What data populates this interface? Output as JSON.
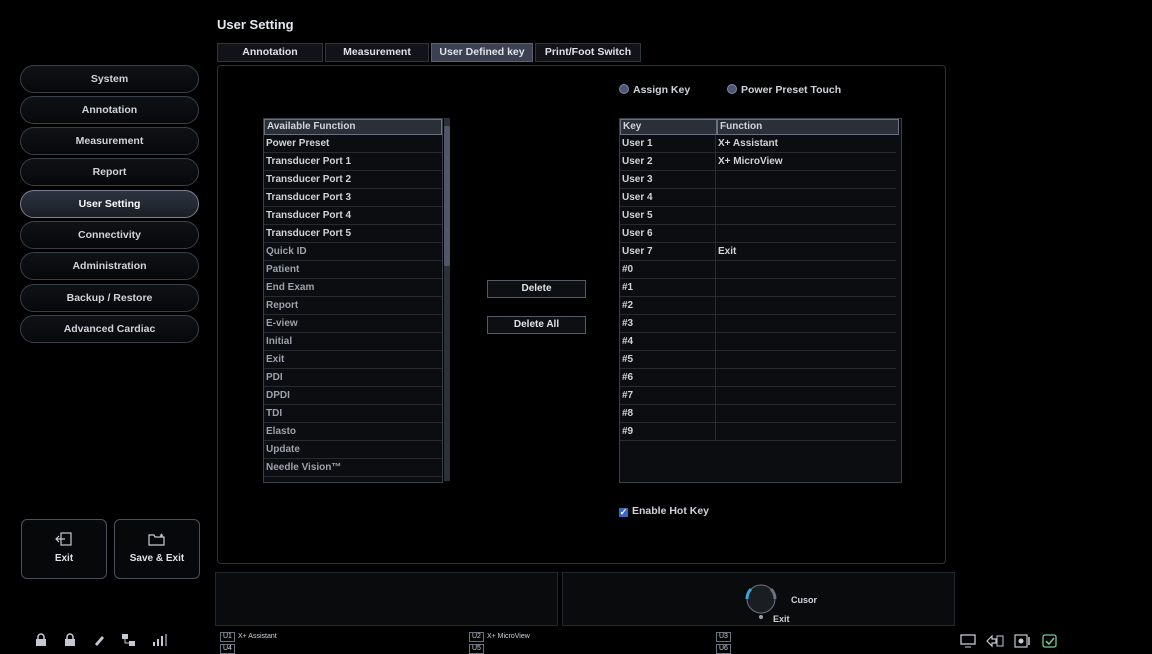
{
  "header": {
    "title": "User Setting"
  },
  "tabs": [
    {
      "label": "Annotation"
    },
    {
      "label": "Measurement"
    },
    {
      "label": "User Defined key"
    },
    {
      "label": "Print/Foot Switch"
    }
  ],
  "sidebar": {
    "items": [
      {
        "label": "System"
      },
      {
        "label": "Annotation"
      },
      {
        "label": "Measurement"
      },
      {
        "label": "Report"
      },
      {
        "label": "User Setting"
      },
      {
        "label": "Connectivity"
      },
      {
        "label": "Administration"
      },
      {
        "label": "Backup / Restore"
      },
      {
        "label": "Advanced Cardiac"
      }
    ],
    "exit_label": "Exit",
    "save_exit_label": "Save & Exit"
  },
  "available": {
    "header": "Available Function",
    "items": [
      "Power Preset",
      "Transducer Port 1",
      "Transducer Port 2",
      "Transducer Port 3",
      "Transducer Port 4",
      "Transducer Port 5",
      "Quick ID",
      "Patient",
      "End Exam",
      "Report",
      "E-view",
      "Initial",
      "Exit",
      "PDI",
      "DPDI",
      "TDI",
      "Elasto",
      "Update",
      "Needle Vision™"
    ]
  },
  "buttons": {
    "delete": "Delete",
    "delete_all": "Delete All"
  },
  "mode": {
    "assign_key": "Assign Key",
    "power_preset_touch": "Power Preset Touch"
  },
  "keys_table": {
    "headers": {
      "key": "Key",
      "function": "Function"
    },
    "rows": [
      {
        "key": "User 1",
        "function": "X+ Assistant"
      },
      {
        "key": "User 2",
        "function": "X+ MicroView"
      },
      {
        "key": "User 3",
        "function": ""
      },
      {
        "key": "User 4",
        "function": ""
      },
      {
        "key": "User 5",
        "function": ""
      },
      {
        "key": "User 6",
        "function": ""
      },
      {
        "key": "User 7",
        "function": "Exit"
      },
      {
        "key": "#0",
        "function": ""
      },
      {
        "key": "#1",
        "function": ""
      },
      {
        "key": "#2",
        "function": ""
      },
      {
        "key": "#3",
        "function": ""
      },
      {
        "key": "#4",
        "function": ""
      },
      {
        "key": "#5",
        "function": ""
      },
      {
        "key": "#6",
        "function": ""
      },
      {
        "key": "#7",
        "function": ""
      },
      {
        "key": "#8",
        "function": ""
      },
      {
        "key": "#9",
        "function": ""
      }
    ]
  },
  "enable_hot_key": "Enable Hot Key",
  "trackball": {
    "cursor_label": "Cusor",
    "exit_label": "Exit"
  },
  "user_keys": {
    "u1_tag": "U1",
    "u1_label": "X+ Assistant",
    "u2_tag": "U2",
    "u2_label": "X+ MicroView",
    "u3_tag": "U3",
    "u4_tag": "U4",
    "u5_tag": "U5",
    "u6_tag": "U6"
  }
}
